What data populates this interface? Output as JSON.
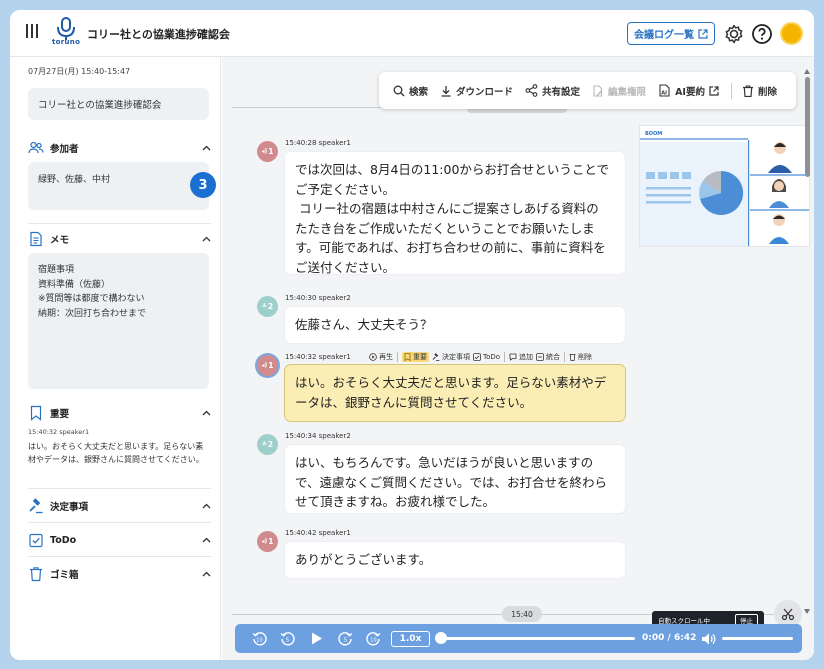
{
  "header": {
    "logo_text": "toruno",
    "title": "コリー社との協業進捗確認会",
    "log_button": "会議ログ一覧"
  },
  "sidebar": {
    "date": "07月27日(月) 15:40-15:47",
    "meeting_title": "コリー社との協業進捗確認会",
    "participants": {
      "label": "参加者",
      "names": "緑野、佐藤、中村",
      "count": "3"
    },
    "memo": {
      "label": "メモ",
      "lines": [
        "宿題事項",
        "資料準備（佐藤）",
        "※質問等は都度で構わない",
        "納期：次回打ち合わせまで"
      ]
    },
    "important": {
      "label": "重要",
      "time": "15:40:32 speaker1",
      "text": "はい。おそらく大丈夫だと思います。足らない素材やデータは、銀野さんに質問させてください。"
    },
    "decisions": {
      "label": "決定事項"
    },
    "todo": {
      "label": "ToDo"
    },
    "trash": {
      "label": "ゴミ箱"
    }
  },
  "toolbar": {
    "search": "検索",
    "download": "ダウンロード",
    "share": "共有設定",
    "edit_permission": "編集権限",
    "ai_summary": "AI要約",
    "delete": "削除"
  },
  "messages": [
    {
      "speaker_badge": "1",
      "meta": "15:40:28 speaker1",
      "lines": [
        "では次回は、8月4日の11:00からお打合せということで",
        "ご予定ください。",
        "コリー社の宿題は中村さんにご提案さしあげる資料の",
        "たたき台をご作成いただくということでお願いたしま",
        "す。可能であれば、お打ち合わせの前に、事前に資料を",
        "ご送付ください。"
      ]
    },
    {
      "speaker_badge": "2",
      "meta": "15:40:30 speaker2",
      "lines": [
        "佐藤さん、大丈夫そう？"
      ]
    },
    {
      "speaker_badge": "1",
      "meta": "15:40:32 speaker1",
      "lines": [
        "はい。おそらく大丈夫だと思います。足らない素材やデ",
        "ータは、銀野さんに質問させてください。"
      ],
      "tools": {
        "play": "再生",
        "important": "重要",
        "decision": "決定事項",
        "todo": "ToDo",
        "add": "追加",
        "merge": "統合",
        "delete": "削除"
      }
    },
    {
      "speaker_badge": "2",
      "meta": "15:40:34 speaker2",
      "lines": [
        "はい、もちろんです。急いだほうが良いと思いますの",
        "で、遠慮なくご質問ください。では、お打合せを終わら",
        "せて頂きますね。お疲れ様でした。"
      ]
    },
    {
      "speaker_badge": "1",
      "meta": "15:40:42 speaker1",
      "lines": [
        "ありがとうございます。"
      ]
    }
  ],
  "slide": {
    "label": "BOOM"
  },
  "timeline": {
    "marker": "15:40"
  },
  "autoscroll": {
    "label": "自動スクロール中",
    "stop": "停止"
  },
  "player": {
    "speed": "1.0x",
    "time": "0:00 / 6:42",
    "progress": 0
  },
  "colors": {
    "accent": "#1a6fd0",
    "player": "#6ca0e0",
    "highlight": "#fbeeb5",
    "speaker1": "#d18b8e",
    "speaker2": "#9dcfcb"
  }
}
